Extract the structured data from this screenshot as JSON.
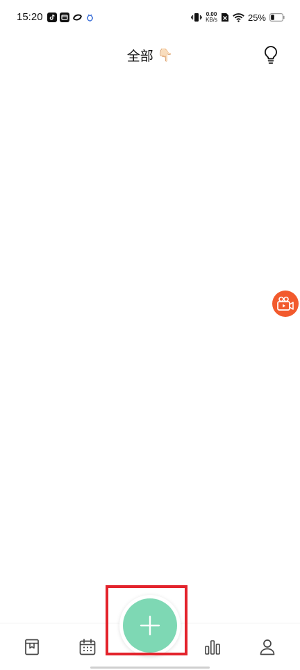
{
  "status_bar": {
    "time": "15:20",
    "net_speed_value": "0.00",
    "net_speed_unit": "KB/s",
    "battery_percent": "25%"
  },
  "header": {
    "title": "全部",
    "title_emoji": "👇🏻"
  },
  "bottom_nav": {
    "items": [
      {
        "icon": "book-icon"
      },
      {
        "icon": "calendar-icon"
      },
      {
        "icon": "add-icon"
      },
      {
        "icon": "bar-chart-icon"
      },
      {
        "icon": "person-icon"
      }
    ]
  },
  "colors": {
    "accent": "#7ed8b4",
    "record_fab": "#f25a2d",
    "highlight": "#e3232c"
  }
}
